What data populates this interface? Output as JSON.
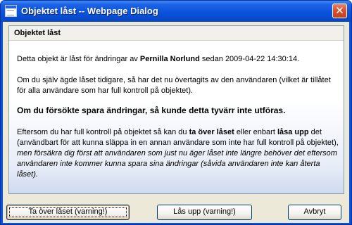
{
  "window": {
    "title": "Objektet låst -- Webpage Dialog",
    "close_glyph": "✕"
  },
  "panel": {
    "title": "Objektet låst"
  },
  "message": {
    "p1_prefix": "Detta objekt är låst för ändringar av ",
    "p1_user": "Pernilla Norlund",
    "p1_mid": " sedan ",
    "p1_timestamp": "2009-04-22 14:30:14",
    "p1_suffix": ".",
    "p2": "Om du själv ägde låset tidigare, så har det nu övertagits av den användaren (vilket är tillåtet för alla användare som har full kontroll på objektet).",
    "p3": "Om du försökte spara ändringar, så kunde detta tyvärr inte utföras.",
    "p4_a": "Eftersom du har full kontroll på objektet så kan du ",
    "p4_b": "ta över låset",
    "p4_c": " eller enbart ",
    "p4_d": "låsa upp",
    "p4_e": " det (användbart för att kunna släppa in en annan användare som inte har full kontroll på objektet),",
    "p4_f": " men försäkra dig först att användaren som just nu äger låset inte längre behöver det eftersom användaren inte kommer kunna spara sina ändringar (såvida användaren inte kan återta låset)."
  },
  "buttons": {
    "take_over": "Ta över låset (varning!)",
    "unlock": "Lås upp (varning!)",
    "cancel": "Avbryt"
  }
}
